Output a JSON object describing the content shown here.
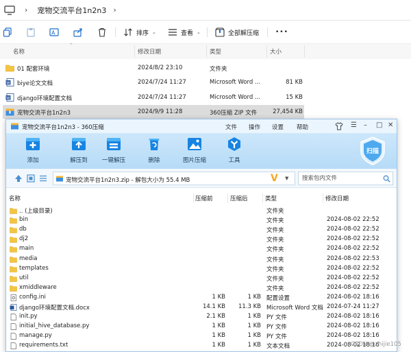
{
  "explorer": {
    "breadcrumb": "宠物交流平台1n2n3",
    "toolbar": {
      "sort": "排序",
      "view": "查看",
      "extract_all": "全部解压缩",
      "more": "•••"
    },
    "columns": {
      "name": "名称",
      "modified": "修改日期",
      "type": "类型",
      "size": "大小"
    },
    "rows": [
      {
        "name": "01 配套环境",
        "date": "2024/8/2 23:10",
        "type": "文件夹",
        "size": "",
        "icon": "folder-icon"
      },
      {
        "name": "biye论文文档",
        "date": "2024/7/24 11:27",
        "type": "Microsoft Word ...",
        "size": "81 KB",
        "icon": "word-icon"
      },
      {
        "name": "django环境配置文档",
        "date": "2024/7/24 11:27",
        "type": "Microsoft Word ...",
        "size": "15 KB",
        "icon": "word-icon"
      },
      {
        "name": "宠物交流平台1n2n3",
        "date": "2024/9/9 11:28",
        "type": "360压缩 ZIP 文件",
        "size": "27,454 KB",
        "icon": "zip-icon",
        "selected": true
      }
    ]
  },
  "zip": {
    "title": "宠物交流平台1n2n3 - 360压缩",
    "menu": [
      "文件",
      "操作",
      "设置",
      "帮助"
    ],
    "ribbon": [
      "添加",
      "解压到",
      "一键解压",
      "删除",
      "图片压缩",
      "工具"
    ],
    "scan_label": "扫描",
    "address": "宠物交流平台1n2n3.zip - 解包大小为 55.4 MB",
    "search_placeholder": "搜索包内文件",
    "columns": {
      "name": "名称",
      "before": "压缩前",
      "after": "压缩后",
      "type": "类型",
      "modified": "修改日期"
    },
    "rows": [
      {
        "name": ".. (上级目录)",
        "before": "",
        "after": "",
        "type": "文件夹",
        "date": "",
        "icon": "folder"
      },
      {
        "name": "bin",
        "before": "",
        "after": "",
        "type": "文件夹",
        "date": "2024-08-02 22:52",
        "icon": "folder"
      },
      {
        "name": "db",
        "before": "",
        "after": "",
        "type": "文件夹",
        "date": "2024-08-02 22:52",
        "icon": "folder"
      },
      {
        "name": "dj2",
        "before": "",
        "after": "",
        "type": "文件夹",
        "date": "2024-08-02 22:52",
        "icon": "folder"
      },
      {
        "name": "main",
        "before": "",
        "after": "",
        "type": "文件夹",
        "date": "2024-08-02 22:52",
        "icon": "folder"
      },
      {
        "name": "media",
        "before": "",
        "after": "",
        "type": "文件夹",
        "date": "2024-08-02 22:53",
        "icon": "folder"
      },
      {
        "name": "templates",
        "before": "",
        "after": "",
        "type": "文件夹",
        "date": "2024-08-02 22:52",
        "icon": "folder"
      },
      {
        "name": "util",
        "before": "",
        "after": "",
        "type": "文件夹",
        "date": "2024-08-02 22:52",
        "icon": "folder"
      },
      {
        "name": "xmiddleware",
        "before": "",
        "after": "",
        "type": "文件夹",
        "date": "2024-08-02 22:52",
        "icon": "folder"
      },
      {
        "name": "config.ini",
        "before": "1 KB",
        "after": "1 KB",
        "type": "配置设置",
        "date": "2024-08-02 18:16",
        "icon": "ini"
      },
      {
        "name": "django环境配置文档.docx",
        "before": "14.1 KB",
        "after": "11.3 KB",
        "type": "Microsoft Word 文档",
        "date": "2024-07-24 11:27",
        "icon": "word"
      },
      {
        "name": "init.py",
        "before": "2.1 KB",
        "after": "1 KB",
        "type": "PY 文件",
        "date": "2024-08-02 18:16",
        "icon": "file"
      },
      {
        "name": "initial_hive_database.py",
        "before": "1 KB",
        "after": "1 KB",
        "type": "PY 文件",
        "date": "2024-08-02 18:16",
        "icon": "file"
      },
      {
        "name": "manage.py",
        "before": "1 KB",
        "after": "1 KB",
        "type": "PY 文件",
        "date": "2024-08-02 18:16",
        "icon": "file"
      },
      {
        "name": "requirements.txt",
        "before": "1 KB",
        "after": "1 KB",
        "type": "文本文档",
        "date": "2024-08-02 18:16",
        "icon": "file"
      }
    ]
  },
  "watermark": "CSDN @zhijie105"
}
